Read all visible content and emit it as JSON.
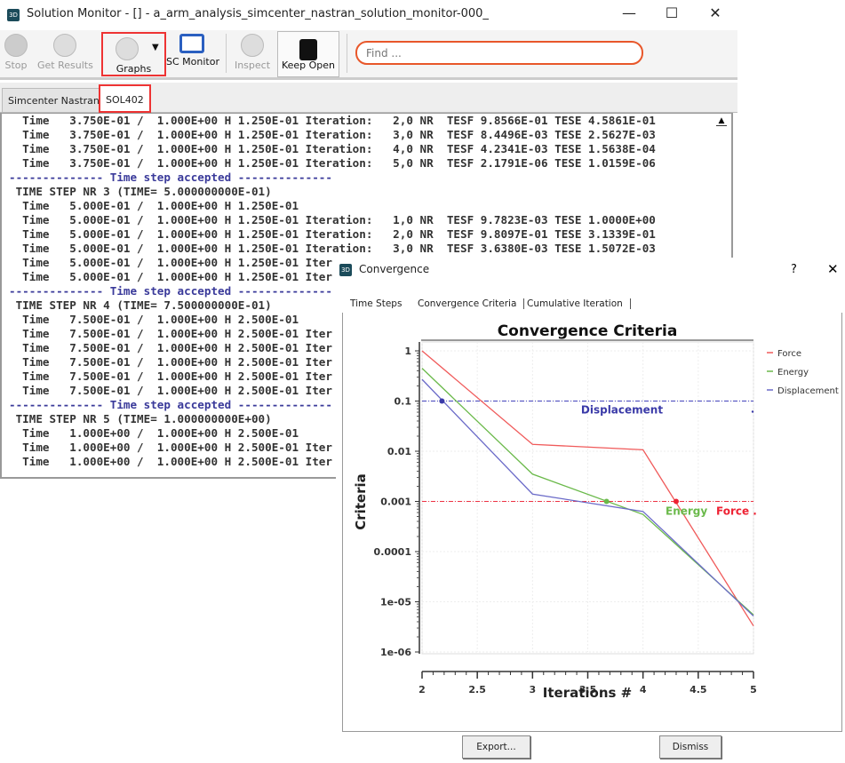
{
  "window": {
    "title": "Solution Monitor - [] - a_arm_analysis_simcenter_nastran_solution_monitor-000_",
    "icon_label": "3D"
  },
  "toolbar": {
    "stop": "Stop",
    "get_results": "Get Results",
    "graphs": "Graphs",
    "sc_monitor": "SC Monitor",
    "inspect": "Inspect",
    "keep_open": "Keep Open",
    "find_placeholder": "Find ..."
  },
  "tabs": [
    "Simcenter Nastran",
    "SOL402"
  ],
  "console_lines": [
    {
      "t": "  Time   3.750E-01 /  1.000E+00 H 1.250E-01 Iteration:   2,0 NR  TESF 9.8566E-01 TESE 4.5861E-01",
      "acc": false
    },
    {
      "t": "  Time   3.750E-01 /  1.000E+00 H 1.250E-01 Iteration:   3,0 NR  TESF 8.4496E-03 TESE 2.5627E-03",
      "acc": false
    },
    {
      "t": "  Time   3.750E-01 /  1.000E+00 H 1.250E-01 Iteration:   4,0 NR  TESF 4.2341E-03 TESE 1.5638E-04",
      "acc": false
    },
    {
      "t": "  Time   3.750E-01 /  1.000E+00 H 1.250E-01 Iteration:   5,0 NR  TESF 2.1791E-06 TESE 1.0159E-06",
      "acc": false
    },
    {
      "t": "-------------- Time step accepted --------------",
      "acc": true
    },
    {
      "t": " TIME STEP NR 3 (TIME= 5.000000000E-01)",
      "acc": false
    },
    {
      "t": "  Time   5.000E-01 /  1.000E+00 H 1.250E-01",
      "acc": false
    },
    {
      "t": "  Time   5.000E-01 /  1.000E+00 H 1.250E-01 Iteration:   1,0 NR  TESF 9.7823E-03 TESE 1.0000E+00",
      "acc": false
    },
    {
      "t": "  Time   5.000E-01 /  1.000E+00 H 1.250E-01 Iteration:   2,0 NR  TESF 9.8097E-01 TESE 3.1339E-01",
      "acc": false
    },
    {
      "t": "  Time   5.000E-01 /  1.000E+00 H 1.250E-01 Iteration:   3,0 NR  TESF 3.6380E-03 TESE 1.5072E-03",
      "acc": false
    },
    {
      "t": "  Time   5.000E-01 /  1.000E+00 H 1.250E-01 Iter",
      "acc": false
    },
    {
      "t": "  Time   5.000E-01 /  1.000E+00 H 1.250E-01 Iter",
      "acc": false
    },
    {
      "t": "-------------- Time step accepted --------------",
      "acc": true
    },
    {
      "t": " TIME STEP NR 4 (TIME= 7.500000000E-01)",
      "acc": false
    },
    {
      "t": "  Time   7.500E-01 /  1.000E+00 H 2.500E-01",
      "acc": false
    },
    {
      "t": "  Time   7.500E-01 /  1.000E+00 H 2.500E-01 Iter",
      "acc": false
    },
    {
      "t": "  Time   7.500E-01 /  1.000E+00 H 2.500E-01 Iter",
      "acc": false
    },
    {
      "t": "  Time   7.500E-01 /  1.000E+00 H 2.500E-01 Iter",
      "acc": false
    },
    {
      "t": "  Time   7.500E-01 /  1.000E+00 H 2.500E-01 Iter",
      "acc": false
    },
    {
      "t": "  Time   7.500E-01 /  1.000E+00 H 2.500E-01 Iter",
      "acc": false
    },
    {
      "t": "-------------- Time step accepted --------------",
      "acc": true
    },
    {
      "t": " TIME STEP NR 5 (TIME= 1.000000000E+00)",
      "acc": false
    },
    {
      "t": "  Time   1.000E+00 /  1.000E+00 H 2.500E-01",
      "acc": false
    },
    {
      "t": "  Time   1.000E+00 /  1.000E+00 H 2.500E-01 Iter",
      "acc": false
    },
    {
      "t": "  Time   1.000E+00 /  1.000E+00 H 2.500E-01 Iter",
      "acc": false
    }
  ],
  "dialog": {
    "title": "Convergence",
    "help": "?",
    "close": "✕",
    "tabs": [
      "Time Steps",
      "Convergence Criteria",
      "Cumulative Iteration"
    ],
    "export": "Export...",
    "dismiss": "Dismiss"
  },
  "chart_data": {
    "type": "line",
    "title": "Convergence Criteria",
    "xlabel": "Iterations #",
    "ylabel": "Criteria",
    "xlim": [
      2,
      5
    ],
    "ylim": [
      1e-06,
      1
    ],
    "yscale": "log",
    "grid": true,
    "legend": "right",
    "xticks": [
      "2",
      "2.5",
      "3",
      "3.5",
      "4",
      "4.5",
      "5"
    ],
    "yticks": [
      "1",
      "0.1",
      "0.01",
      "0.001",
      "0.0001",
      "1e-05",
      "1e-06"
    ],
    "x": [
      2,
      3,
      4,
      5
    ],
    "series": [
      {
        "name": "Force",
        "color": "#f05a5a",
        "values": [
          1.0,
          0.0137,
          0.0107,
          3.3e-06
        ]
      },
      {
        "name": "Energy",
        "color": "#6ab94a",
        "values": [
          0.45,
          0.0035,
          0.00055,
          5.5e-06
        ]
      },
      {
        "name": "Displacement",
        "color": "#6a6ac8",
        "values": [
          0.27,
          0.0014,
          0.00063,
          5.2e-06
        ]
      }
    ],
    "thresholds": [
      {
        "value": 0.1,
        "color": "#4444bb",
        "labels": [
          {
            "text": "Displacement",
            "color": "#3a3aa8"
          }
        ],
        "markers": [
          {
            "x": 2.18,
            "color": "#3a3aa8"
          }
        ]
      },
      {
        "value": 0.001,
        "color": "#ee3344",
        "labels": [
          {
            "text": "Energy",
            "color": "#6ab94a"
          },
          {
            "text": "Force .",
            "color": "#ee2233"
          }
        ],
        "markers": [
          {
            "x": 3.67,
            "color": "#6ab94a"
          },
          {
            "x": 4.3,
            "color": "#ee2233"
          }
        ]
      }
    ]
  }
}
